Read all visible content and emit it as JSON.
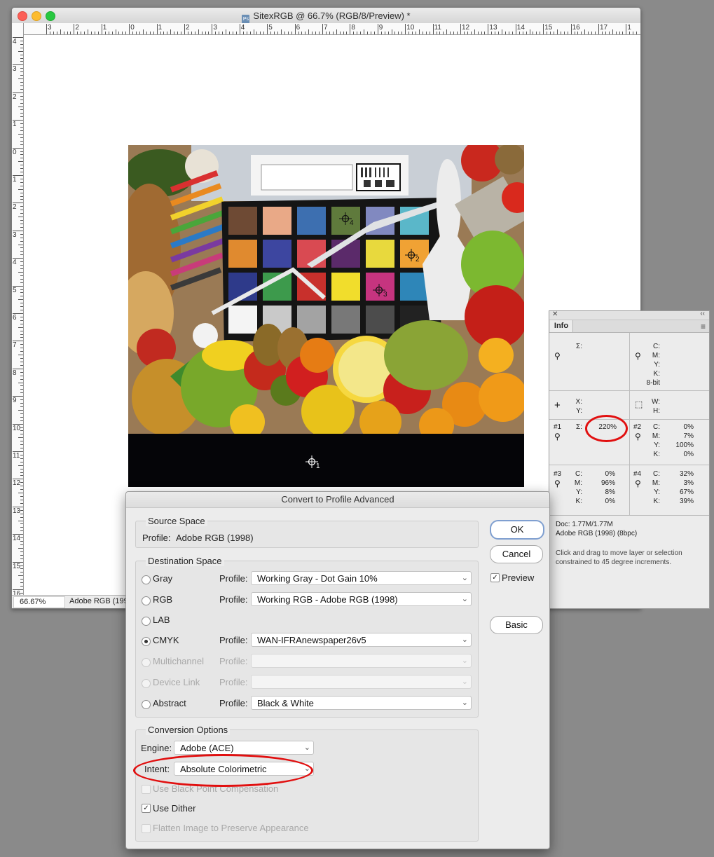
{
  "document": {
    "title": "SitexRGB @ 66.7% (RGB/8/Preview) *",
    "zoom": "66.67%",
    "status_profile": "Adobe RGB (1998",
    "ruler_top": [
      "3",
      "2",
      "1",
      "0",
      "1",
      "2",
      "3",
      "4",
      "5",
      "6",
      "7",
      "8",
      "9",
      "10",
      "11",
      "12",
      "13",
      "14",
      "15",
      "16",
      "17",
      "1"
    ],
    "ruler_left": [
      "4",
      "3",
      "2",
      "1",
      "0",
      "1",
      "2",
      "3",
      "4",
      "5",
      "6",
      "7",
      "8",
      "9",
      "10",
      "11",
      "12",
      "13",
      "14",
      "15",
      "16",
      "17"
    ]
  },
  "photo": {
    "markers": [
      "1",
      "2",
      "3",
      "4"
    ],
    "colors": [
      "#6e4a34",
      "#e9a987",
      "#3d6fb0",
      "#5f7a3c",
      "#8189c0",
      "#5ab7c9",
      "#e08a2f",
      "#3d46a0",
      "#d94a52",
      "#5b2a6a",
      "#e8d93d",
      "#f0a234",
      "#2e3a8a",
      "#3d9a4c",
      "#c8302c",
      "#f1dd2c",
      "#c6347f",
      "#2e86b8",
      "#f4f4f4",
      "#c9c9c9",
      "#a3a3a3",
      "#787878",
      "#4c4c4c",
      "#222222"
    ]
  },
  "info": {
    "tab": "Info",
    "sigma": "Σ:",
    "cmyk_labels": [
      "C:",
      "M:",
      "Y:",
      "K:"
    ],
    "bit_depth": "8-bit",
    "xy_labels": [
      "X:",
      "Y:"
    ],
    "wh_labels": [
      "W:",
      "H:"
    ],
    "s1_label": "#1",
    "s1_total": "220%",
    "s2_label": "#2",
    "s2_values": [
      "0%",
      "7%",
      "100%",
      "0%"
    ],
    "s3_label": "#3",
    "s3_values": [
      "0%",
      "96%",
      "8%",
      "0%"
    ],
    "s4_label": "#4",
    "s4_values": [
      "32%",
      "3%",
      "67%",
      "39%"
    ],
    "doc_size": "Doc: 1.77M/1.77M",
    "doc_profile": "Adobe RGB (1998) (8bpc)",
    "hint_line1": "Click and drag to move layer or selection",
    "hint_line2": "constrained to 45 degree increments."
  },
  "dialog": {
    "title": "Convert to Profile Advanced",
    "source_label": "Source Space",
    "source_profile_label": "Profile:",
    "source_profile_value": "Adobe RGB (1998)",
    "dest_label": "Destination Space",
    "profile_label": "Profile:",
    "rows": [
      {
        "name": "Gray",
        "value": "Working Gray - Dot Gain 10%"
      },
      {
        "name": "RGB",
        "value": "Working RGB - Adobe RGB (1998)"
      },
      {
        "name": "LAB",
        "value": ""
      },
      {
        "name": "CMYK",
        "value": "WAN-IFRAnewspaper26v5"
      },
      {
        "name": "Multichannel",
        "value": ""
      },
      {
        "name": "Device Link",
        "value": ""
      },
      {
        "name": "Abstract",
        "value": "Black & White"
      }
    ],
    "options_label": "Conversion Options",
    "engine_label": "Engine:",
    "engine_value": "Adobe (ACE)",
    "intent_label": "Intent:",
    "intent_value": "Absolute Colorimetric",
    "bpc_label": "Use Black Point Compensation",
    "dither_label": "Use Dither",
    "flatten_label": "Flatten Image to Preserve Appearance",
    "ok": "OK",
    "cancel": "Cancel",
    "preview": "Preview",
    "basic": "Basic"
  },
  "annotation_color": "#e10f0f"
}
